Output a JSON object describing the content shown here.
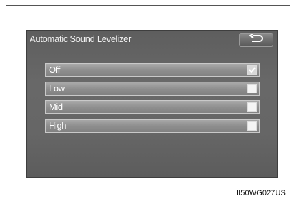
{
  "screen": {
    "title": "Automatic Sound Levelizer",
    "back_icon": "return-arrow-icon",
    "options": [
      {
        "label": "Off",
        "selected": true
      },
      {
        "label": "Low",
        "selected": false
      },
      {
        "label": "Mid",
        "selected": false
      },
      {
        "label": "High",
        "selected": false
      }
    ]
  },
  "caption": "II50WG027US",
  "colors": {
    "screen_bg": "#666666",
    "row_bg": "#8f8f8f",
    "text": "#ffffff"
  }
}
